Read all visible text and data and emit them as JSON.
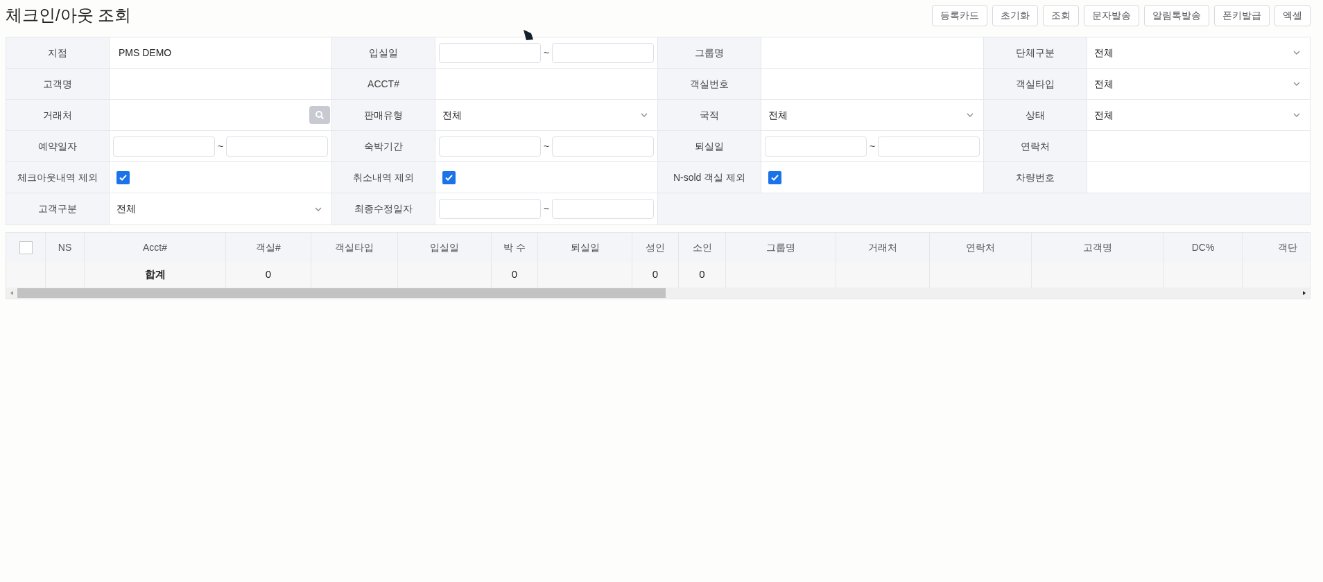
{
  "title": "체크인/아웃 조회",
  "buttons": [
    "등록카드",
    "초기화",
    "조회",
    "문자발송",
    "알림톡발송",
    "폰키발급",
    "엑셀"
  ],
  "form_rows": [
    [
      {
        "label": "지점",
        "field": {
          "kind": "text",
          "value": "PMS DEMO"
        }
      },
      {
        "label": "입실일",
        "field": {
          "kind": "daterange",
          "separator": "~"
        }
      },
      {
        "label": "그룹명",
        "field": {
          "kind": "text"
        }
      },
      {
        "label": "단체구분",
        "field": {
          "kind": "select",
          "value": "전체"
        }
      }
    ],
    [
      {
        "label": "고객명",
        "field": {
          "kind": "text"
        }
      },
      {
        "label": "ACCT#",
        "field": {
          "kind": "text"
        }
      },
      {
        "label": "객실번호",
        "field": {
          "kind": "text"
        }
      },
      {
        "label": "객실타입",
        "field": {
          "kind": "select",
          "value": "전체"
        }
      }
    ],
    [
      {
        "label": "거래처",
        "field": {
          "kind": "search"
        }
      },
      {
        "label": "판매유형",
        "field": {
          "kind": "select",
          "value": "전체"
        }
      },
      {
        "label": "국적",
        "field": {
          "kind": "select",
          "value": "전체"
        }
      },
      {
        "label": "상태",
        "field": {
          "kind": "select",
          "value": "전체"
        }
      }
    ],
    [
      {
        "label": "예약일자",
        "field": {
          "kind": "daterange",
          "separator": "~"
        }
      },
      {
        "label": "숙박기간",
        "field": {
          "kind": "daterange",
          "separator": "~"
        }
      },
      {
        "label": "퇴실일",
        "field": {
          "kind": "daterange",
          "separator": "~"
        }
      },
      {
        "label": "연락처",
        "field": {
          "kind": "text"
        }
      }
    ],
    [
      {
        "label": "체크아웃내역 제외",
        "field": {
          "kind": "checkbox",
          "checked": true
        }
      },
      {
        "label": "취소내역 제외",
        "field": {
          "kind": "checkbox",
          "checked": true
        }
      },
      {
        "label": "N-sold 객실 제외",
        "field": {
          "kind": "checkbox",
          "checked": true
        }
      },
      {
        "label": "차량번호",
        "field": {
          "kind": "text"
        }
      }
    ],
    [
      {
        "label": "고객구분",
        "field": {
          "kind": "select",
          "value": "전체"
        }
      },
      {
        "label": "최종수정일자",
        "field": {
          "kind": "daterange",
          "separator": "~"
        }
      }
    ]
  ],
  "table": {
    "select_all_checked": false,
    "columns": [
      {
        "label": "NS"
      },
      {
        "label": "Acct#",
        "total": "합계"
      },
      {
        "label": "객실#",
        "total": "0"
      },
      {
        "label": "객실타입"
      },
      {
        "label": "입실일"
      },
      {
        "label": "박 수",
        "total": "0"
      },
      {
        "label": "퇴실일"
      },
      {
        "label": "성인",
        "total": "0"
      },
      {
        "label": "소인",
        "total": "0"
      },
      {
        "label": "그룹명"
      },
      {
        "label": "거래처"
      },
      {
        "label": "연락처"
      },
      {
        "label": "고객명"
      },
      {
        "label": "DC%"
      },
      {
        "label": "객단"
      }
    ]
  }
}
